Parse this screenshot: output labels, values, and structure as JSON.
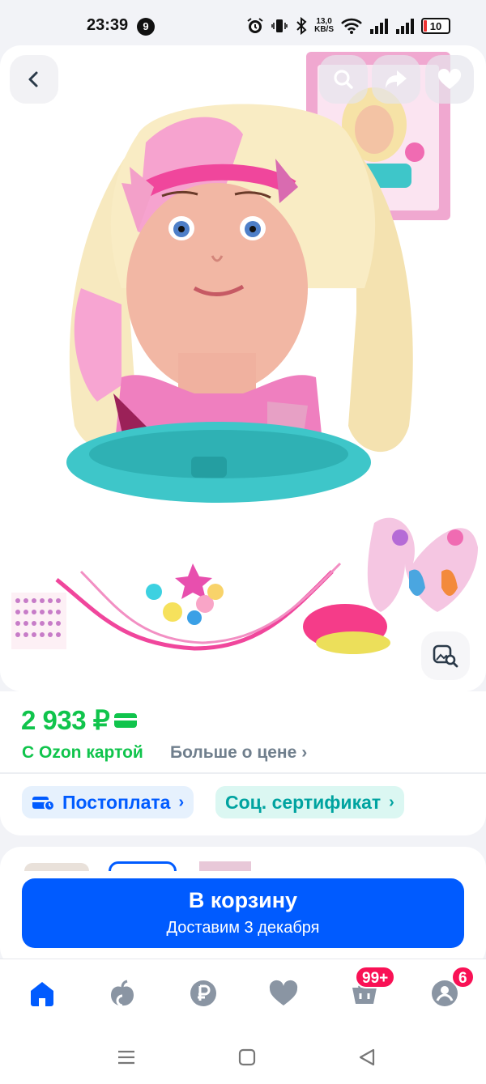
{
  "status_bar": {
    "time": "23:39",
    "notification_count": "9",
    "net_speed_value": "13,0",
    "net_speed_unit": "KB/S",
    "battery_level": "10"
  },
  "gallery": {
    "icons": [
      "back-arrow-icon",
      "search-icon",
      "share-icon",
      "heart-icon",
      "image-search-icon"
    ]
  },
  "price": {
    "value": "2 933 ₽",
    "ozon_card_label": "С Ozon картой",
    "more_about_price": "Больше о цене",
    "chevron": "›"
  },
  "chips": {
    "postpay": "Постоплата",
    "social_certificate": "Соц. сертификат",
    "chevron": "›"
  },
  "cart_button": {
    "title": "В корзину",
    "subtitle": "Доставим 3 декабря"
  },
  "bottom_nav": {
    "cart_badge": "99+",
    "profile_badge": "6",
    "icons": [
      "home-icon",
      "fresh-icon",
      "points-icon",
      "favorites-icon",
      "cart-icon",
      "profile-icon"
    ]
  },
  "colors": {
    "ozon_blue": "#005bff",
    "price_green": "#10c44c",
    "badge_pink": "#f91155"
  }
}
